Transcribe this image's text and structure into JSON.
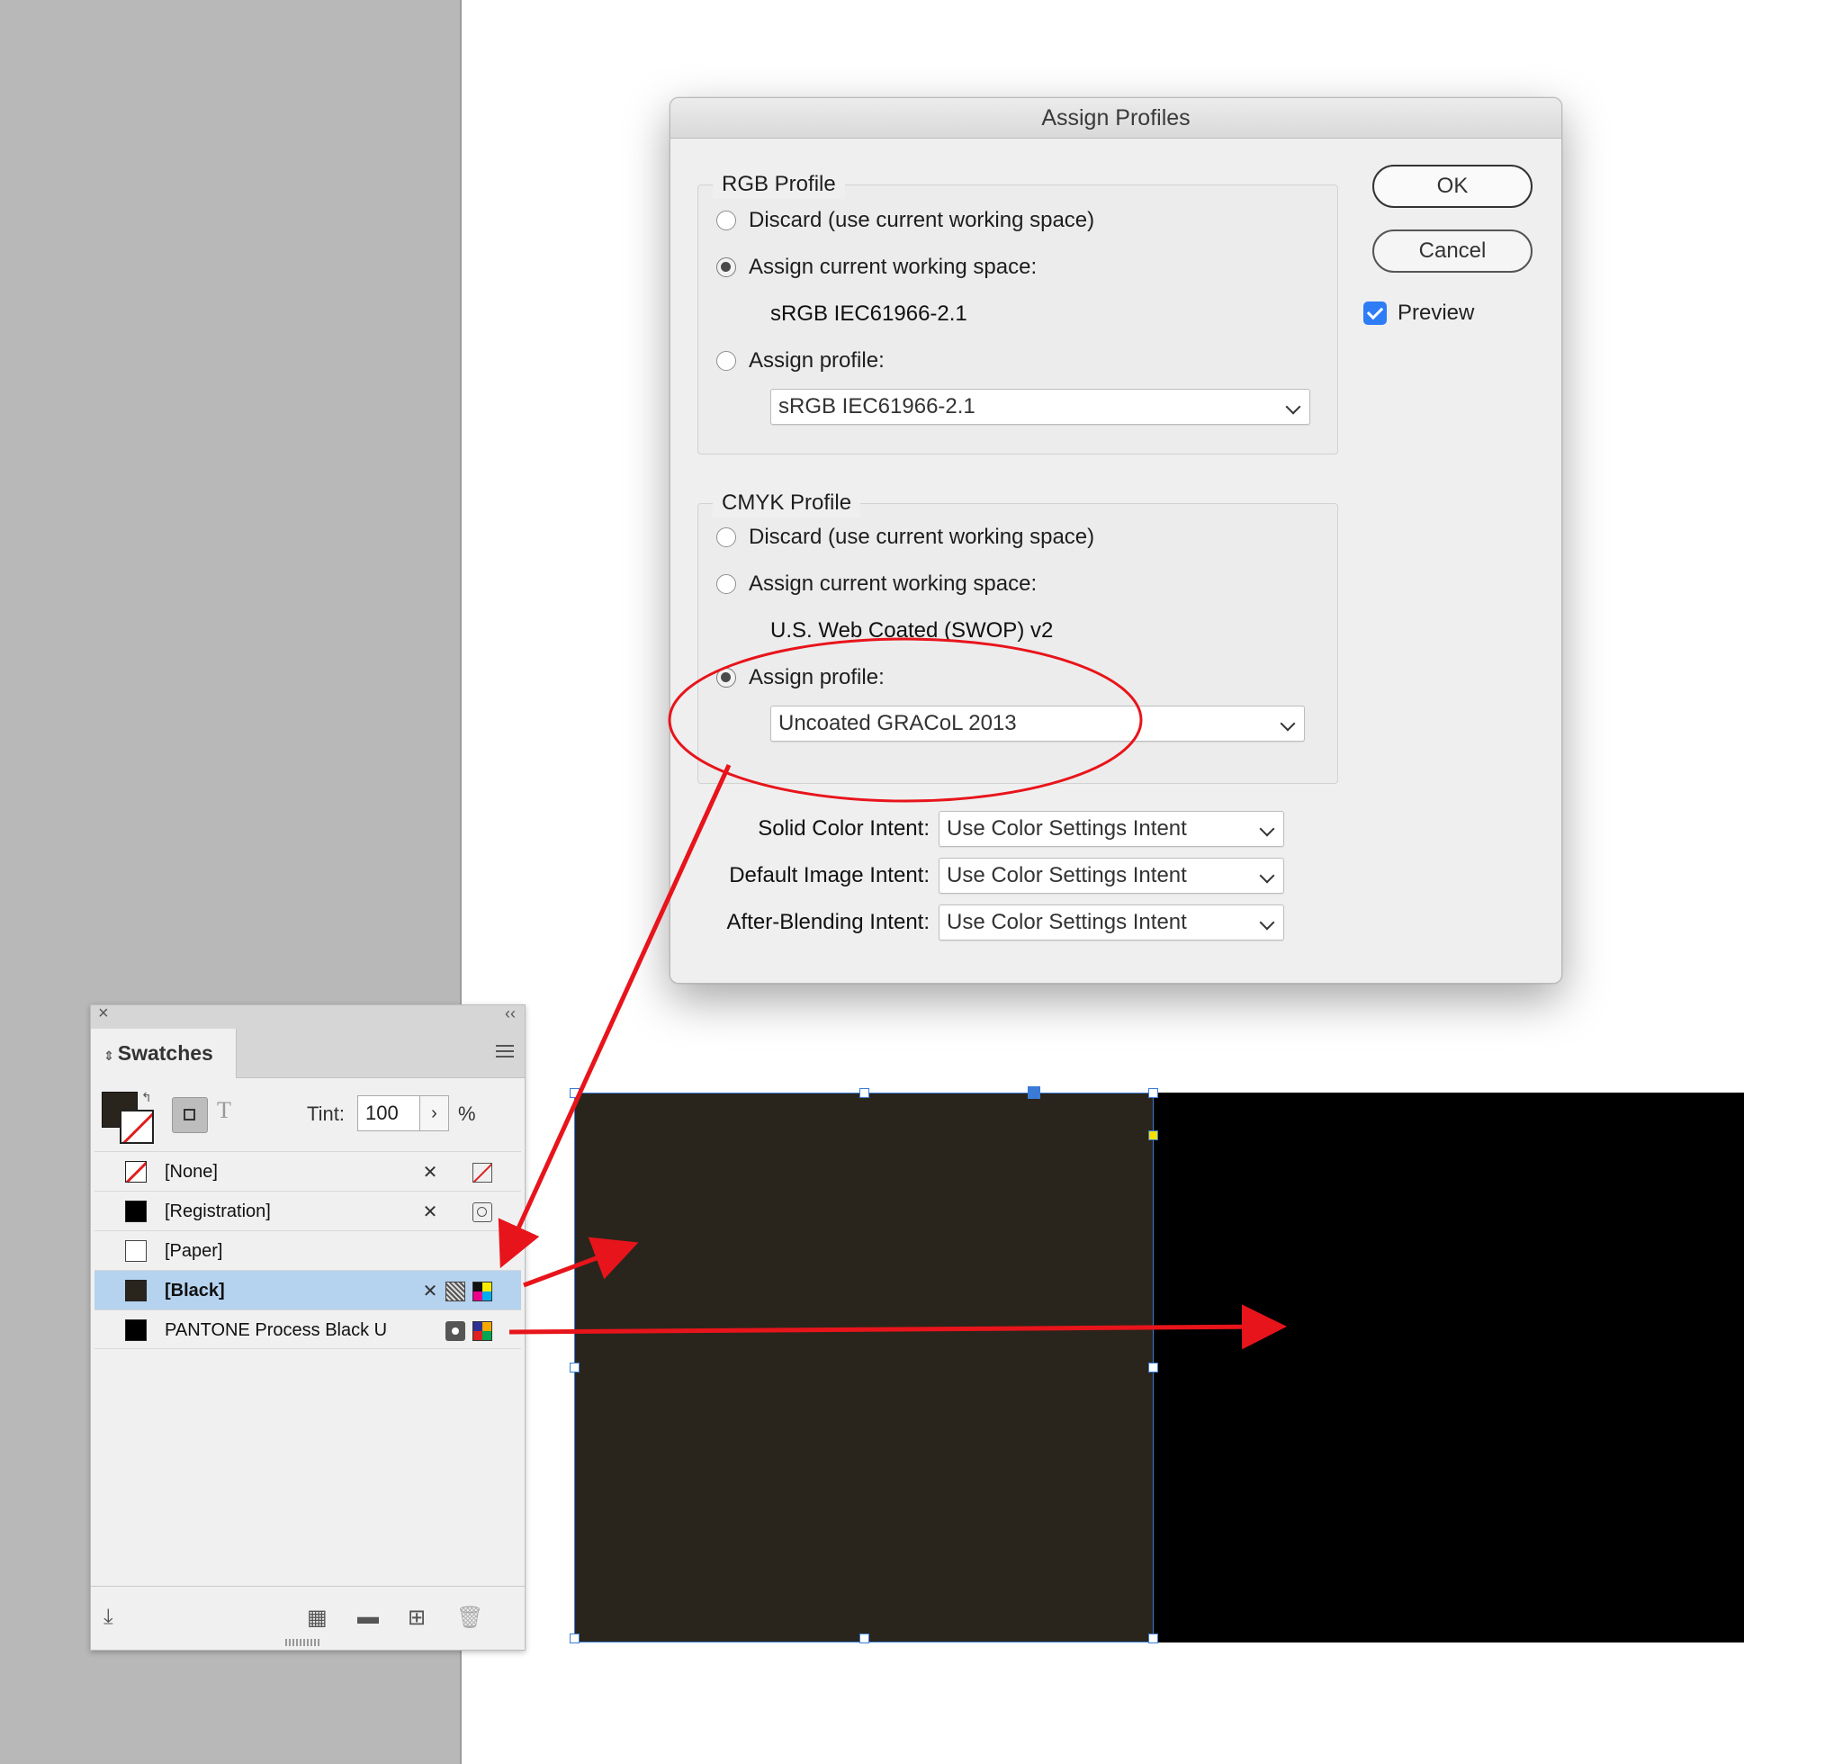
{
  "dialog": {
    "title": "Assign Profiles",
    "rgb": {
      "title": "RGB Profile",
      "discard_label": "Discard (use current working space)",
      "assign_current_label": "Assign current working space:",
      "current_space": "sRGB IEC61966-2.1",
      "assign_profile_label": "Assign profile:",
      "profile_value": "sRGB IEC61966-2.1",
      "selected": "assign_current"
    },
    "cmyk": {
      "title": "CMYK Profile",
      "discard_label": "Discard (use current working space)",
      "assign_current_label": "Assign current working space:",
      "current_space": "U.S. Web Coated (SWOP) v2",
      "assign_profile_label": "Assign profile:",
      "profile_value": "Uncoated GRACoL 2013",
      "selected": "assign_profile"
    },
    "intents": [
      {
        "label": "Solid Color Intent:",
        "value": "Use Color Settings Intent"
      },
      {
        "label": "Default Image Intent:",
        "value": "Use Color Settings Intent"
      },
      {
        "label": "After-Blending Intent:",
        "value": "Use Color Settings Intent"
      }
    ],
    "ok_label": "OK",
    "cancel_label": "Cancel",
    "preview_label": "Preview",
    "preview_checked": true
  },
  "swatches_panel": {
    "tab_label": "Swatches",
    "tint_label": "Tint:",
    "tint_value": "100",
    "tint_unit": "%",
    "swatches": [
      {
        "name": "[None]",
        "chip": "none",
        "nonedit": true,
        "mode": "none-mode-icon"
      },
      {
        "name": "[Registration]",
        "chip": "registration",
        "nonedit": true,
        "mode": "registration-mode-icon"
      },
      {
        "name": "[Paper]",
        "chip": "paper",
        "nonedit": false,
        "mode": ""
      },
      {
        "name": "[Black]",
        "chip": "black",
        "nonedit": true,
        "mode": "cmyk-process-icon",
        "selected": true
      },
      {
        "name": "PANTONE Process Black U",
        "chip": "pantone",
        "nonedit": false,
        "mode": "spot-color-icon"
      }
    ]
  },
  "artwork": {
    "left_fill": "#2a251c",
    "right_fill": "#000000"
  },
  "annotation_color": "#e8141b"
}
